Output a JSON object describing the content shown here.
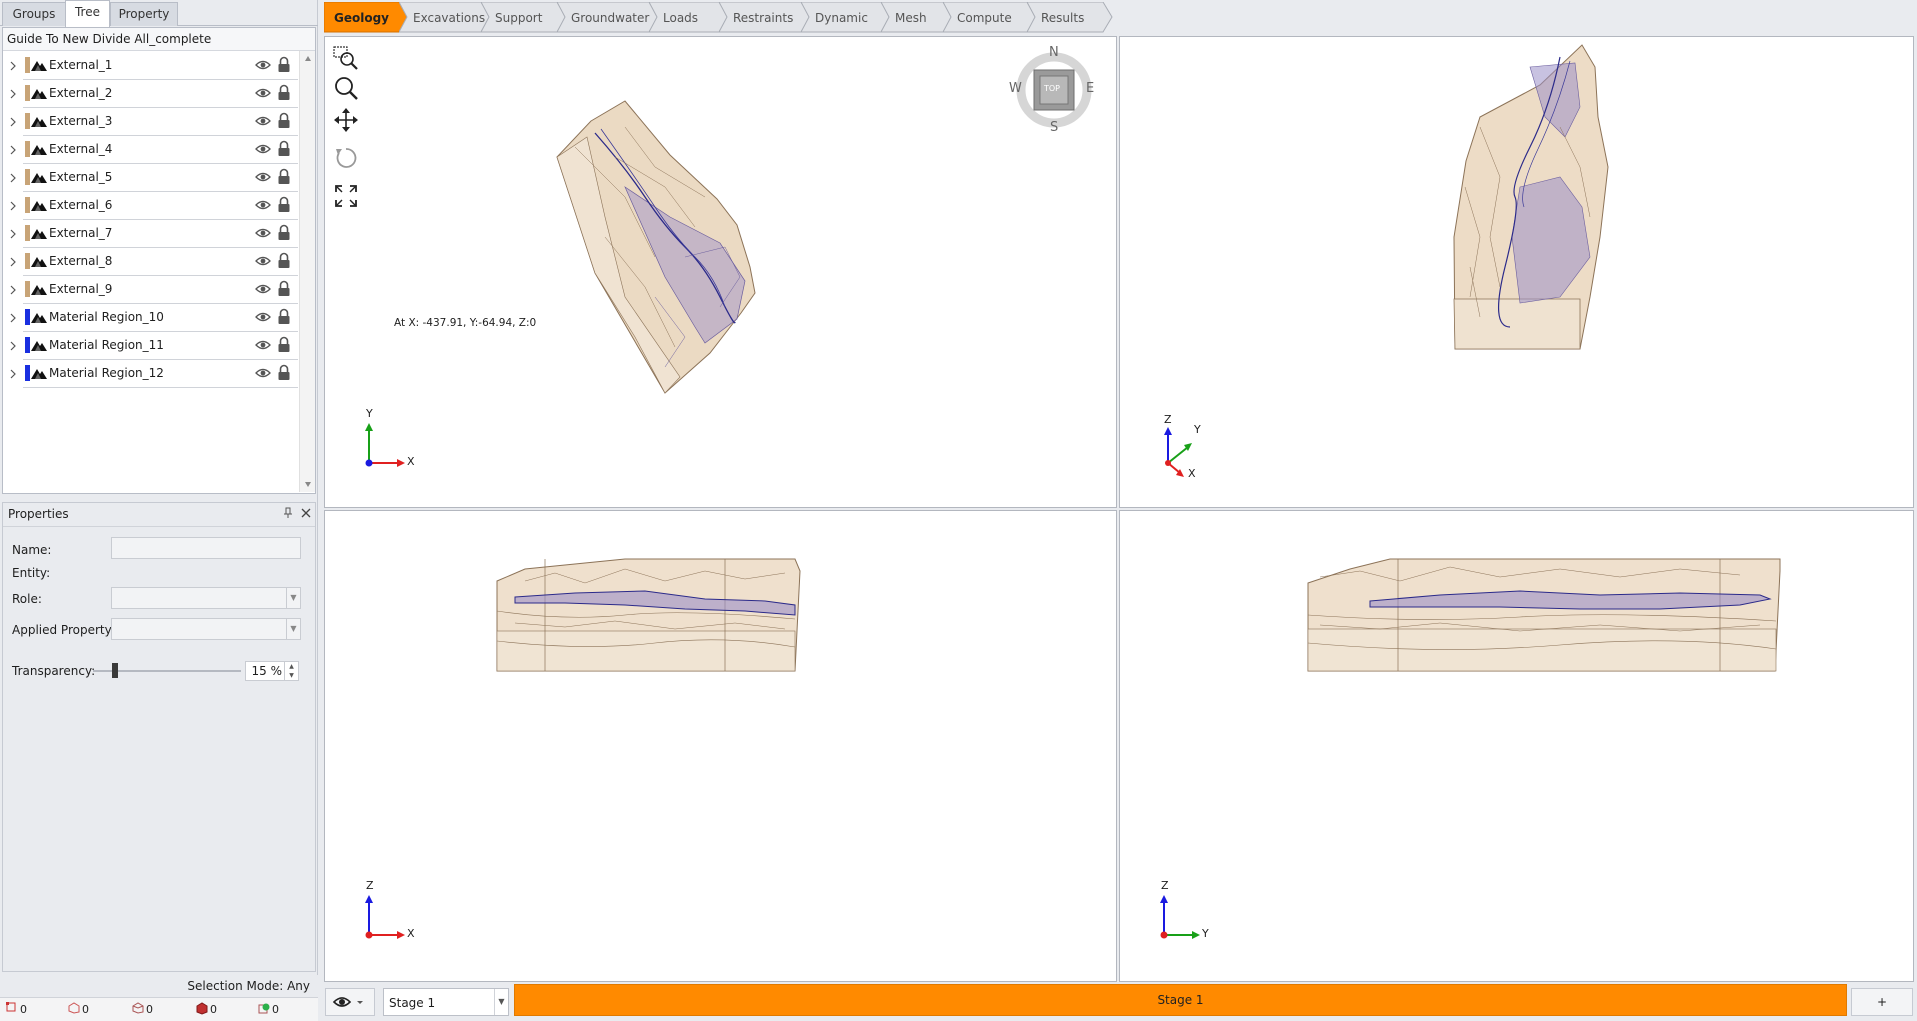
{
  "left_tabs": [
    "Groups",
    "Tree",
    "Property"
  ],
  "active_left_tab": "Tree",
  "tree": {
    "root_label": "Guide To New Divide All_complete",
    "items": [
      {
        "label": "External_1",
        "color": "#c8a477"
      },
      {
        "label": "External_2",
        "color": "#c8a477"
      },
      {
        "label": "External_3",
        "color": "#c8a477"
      },
      {
        "label": "External_4",
        "color": "#c8a477"
      },
      {
        "label": "External_5",
        "color": "#c8a477"
      },
      {
        "label": "External_6",
        "color": "#c8a477"
      },
      {
        "label": "External_7",
        "color": "#c8a477"
      },
      {
        "label": "External_8",
        "color": "#c8a477"
      },
      {
        "label": "External_9",
        "color": "#c8a477"
      },
      {
        "label": "Material Region_10",
        "color": "#1a2fe0"
      },
      {
        "label": "Material Region_11",
        "color": "#1a2fe0"
      },
      {
        "label": "Material Region_12",
        "color": "#1a2fe0"
      }
    ]
  },
  "properties": {
    "title": "Properties",
    "name_label": "Name:",
    "entity_label": "Entity:",
    "role_label": "Role:",
    "applied_property_label": "Applied Property:",
    "transparency_label": "Transparency:",
    "transparency_value": "15 %",
    "transparency_fraction": 0.15
  },
  "selection_mode": "Selection Mode: Any",
  "status_counts": [
    "0",
    "0",
    "0",
    "0",
    "0"
  ],
  "workflow": {
    "active": "Geology",
    "tabs": [
      "Geology",
      "Excavations",
      "Support",
      "Groundwater",
      "Loads",
      "Restraints",
      "Dynamic",
      "Mesh",
      "Compute",
      "Results"
    ],
    "active_color": "#ff8a00"
  },
  "viewport_top": {
    "coord_readout": "At X: -437.91, Y:-64.94, Z:0",
    "compass": {
      "n": "N",
      "s": "S",
      "e": "E",
      "w": "W",
      "center": "TOP"
    },
    "axes": [
      "Y",
      "X"
    ]
  },
  "viewport_iso": {
    "axes": [
      "Z",
      "Y",
      "X"
    ]
  },
  "viewport_front": {
    "axes": [
      "Z",
      "X"
    ]
  },
  "viewport_side": {
    "axes": [
      "Z",
      "Y"
    ]
  },
  "bottom": {
    "stage_select": "Stage 1",
    "stage_bar_label": "Stage 1",
    "add_stage": "+"
  },
  "colors": {
    "rock_fill": "#e8d3b8",
    "rock_line": "#8c7358",
    "region_fill": "#8f86c4",
    "region_line": "#2b2a8a",
    "axis_x": "#e02020",
    "axis_y": "#18a018",
    "axis_z": "#1a1ae0"
  }
}
